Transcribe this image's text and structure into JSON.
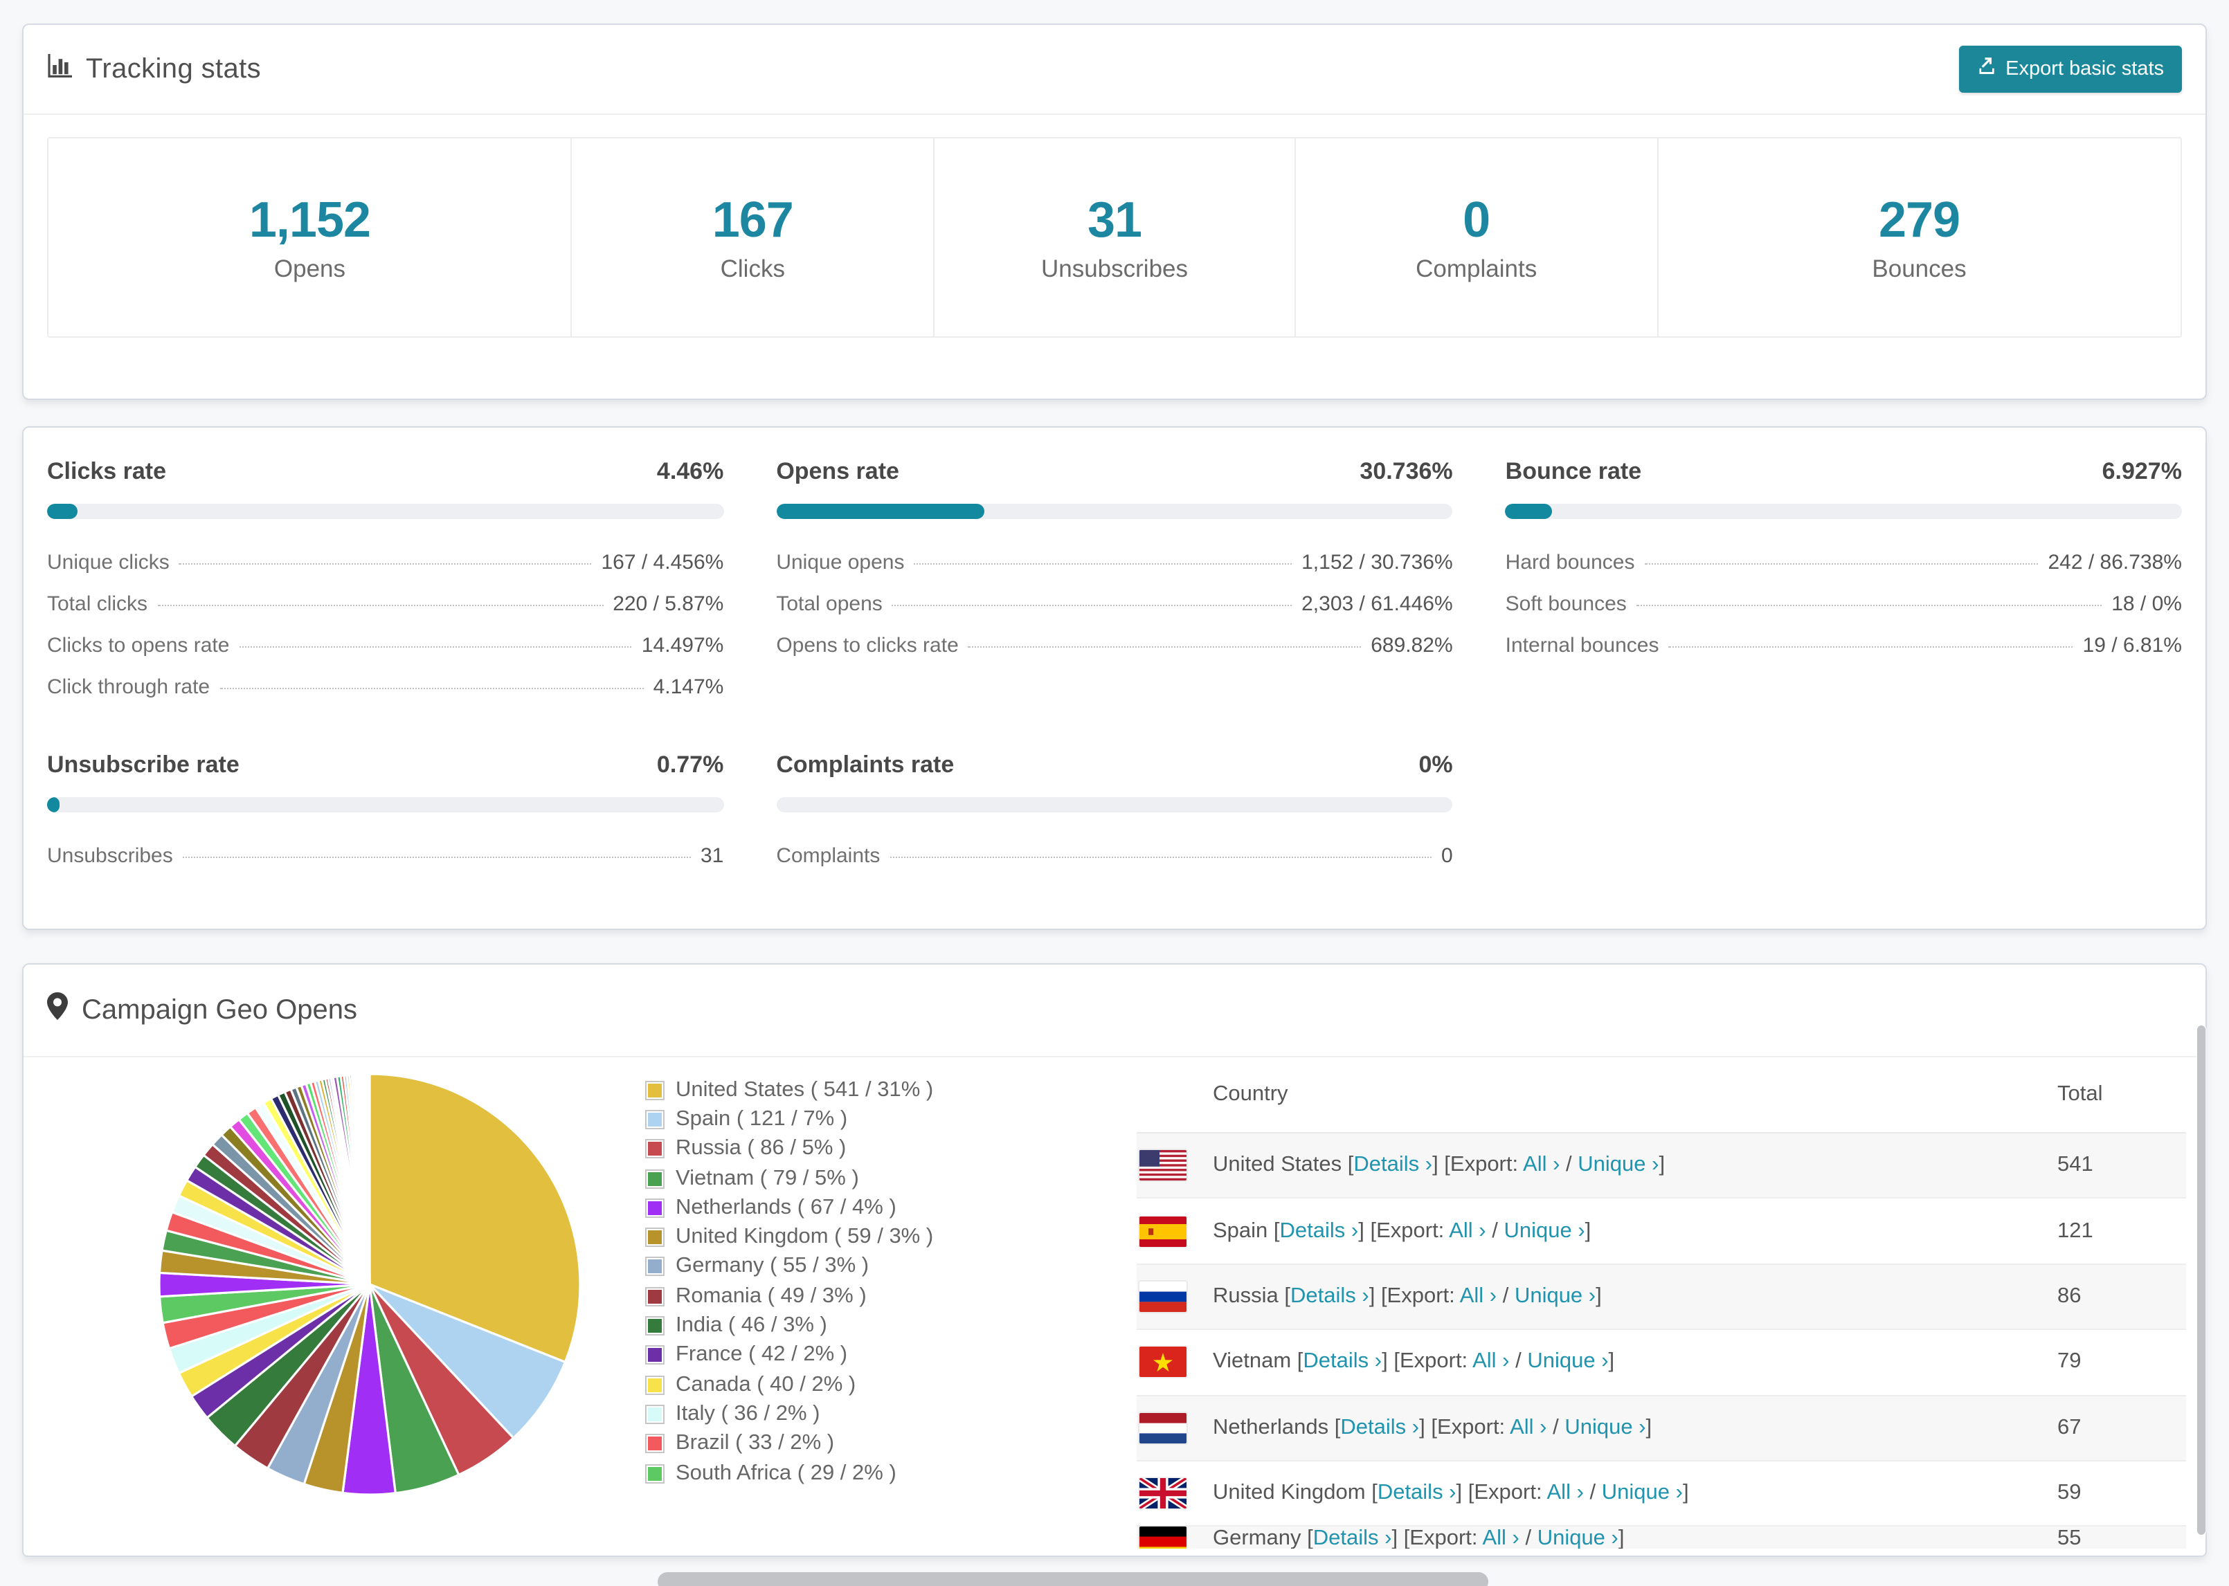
{
  "page": {
    "accent": "#1b8799",
    "accent_text": "#1d87a2",
    "link_color": "#2093ae",
    "background": "#f7f8f9"
  },
  "tracking": {
    "title": "Tracking stats",
    "export_button": "Export basic stats",
    "stats": [
      {
        "value": "1,152",
        "label": "Opens"
      },
      {
        "value": "167",
        "label": "Clicks"
      },
      {
        "value": "31",
        "label": "Unsubscribes"
      },
      {
        "value": "0",
        "label": "Complaints"
      },
      {
        "value": "279",
        "label": "Bounces"
      }
    ]
  },
  "rates": {
    "blocks": [
      {
        "title": "Clicks rate",
        "percent": "4.46%",
        "bar_pct": 4.46,
        "rows": [
          {
            "label": "Unique clicks",
            "value": "167 / 4.456%"
          },
          {
            "label": "Total clicks",
            "value": "220 / 5.87%"
          },
          {
            "label": "Clicks to opens rate",
            "value": "14.497%"
          },
          {
            "label": "Click through rate",
            "value": "4.147%"
          }
        ]
      },
      {
        "title": "Opens rate",
        "percent": "30.736%",
        "bar_pct": 30.736,
        "rows": [
          {
            "label": "Unique opens",
            "value": "1,152 / 30.736%"
          },
          {
            "label": "Total opens",
            "value": "2,303 / 61.446%"
          },
          {
            "label": "Opens to clicks rate",
            "value": "689.82%"
          }
        ]
      },
      {
        "title": "Bounce rate",
        "percent": "6.927%",
        "bar_pct": 6.927,
        "rows": [
          {
            "label": "Hard bounces",
            "value": "242 / 86.738%"
          },
          {
            "label": "Soft bounces",
            "value": "18 / 0%"
          },
          {
            "label": "Internal bounces",
            "value": "19 / 6.81%"
          }
        ]
      },
      {
        "title": "Unsubscribe rate",
        "percent": "0.77%",
        "bar_pct": 0.77,
        "rows": [
          {
            "label": "Unsubscribes",
            "value": "31"
          }
        ]
      },
      {
        "title": "Complaints rate",
        "percent": "0%",
        "bar_pct": 0,
        "rows": [
          {
            "label": "Complaints",
            "value": "0"
          }
        ]
      }
    ]
  },
  "geo": {
    "title": "Campaign Geo Opens",
    "table": {
      "headers": [
        "Country",
        "Total"
      ],
      "bracket_open": "[",
      "bracket_close": "]",
      "details_label": "Details ›",
      "export_prefix": "] [Export: ",
      "all_label": "All ›",
      "separator": " / ",
      "unique_label": "Unique ›",
      "rows": [
        {
          "country": "United States",
          "flag": "us",
          "total": "541",
          "partial": false
        },
        {
          "country": "Spain",
          "flag": "es",
          "total": "121",
          "partial": false
        },
        {
          "country": "Russia",
          "flag": "ru",
          "total": "86",
          "partial": false
        },
        {
          "country": "Vietnam",
          "flag": "vn",
          "total": "79",
          "partial": false
        },
        {
          "country": "Netherlands",
          "flag": "nl",
          "total": "67",
          "partial": false
        },
        {
          "country": "United Kingdom",
          "flag": "gb",
          "total": "59",
          "partial": false
        },
        {
          "country": "Germany",
          "flag": "de",
          "total": "55",
          "partial": true
        }
      ]
    }
  },
  "chart_data": {
    "type": "pie",
    "title": "Campaign Geo Opens",
    "unit": "opens",
    "legend_position": "right",
    "start_angle_deg": 0,
    "direction": "clockwise",
    "slices": [
      {
        "label": "United States",
        "value": 541,
        "pct": 31,
        "color": "#e3bf3f",
        "legend": "United States ( 541 / 31% )"
      },
      {
        "label": "Spain",
        "value": 121,
        "pct": 7,
        "color": "#aed3f0",
        "legend": "Spain ( 121 / 7% )"
      },
      {
        "label": "Russia",
        "value": 86,
        "pct": 5,
        "color": "#c74a50",
        "legend": "Russia ( 86 / 5% )"
      },
      {
        "label": "Vietnam",
        "value": 79,
        "pct": 5,
        "color": "#4ba152",
        "legend": "Vietnam ( 79 / 5% )"
      },
      {
        "label": "Netherlands",
        "value": 67,
        "pct": 4,
        "color": "#a02ef5",
        "legend": "Netherlands ( 67 / 4% )"
      },
      {
        "label": "United Kingdom",
        "value": 59,
        "pct": 3,
        "color": "#b8932b",
        "legend": "United Kingdom ( 59 / 3% )"
      },
      {
        "label": "Germany",
        "value": 55,
        "pct": 3,
        "color": "#92aecc",
        "legend": "Germany ( 55 / 3% )"
      },
      {
        "label": "Romania",
        "value": 49,
        "pct": 3,
        "color": "#a03a41",
        "legend": "Romania ( 49 / 3% )"
      },
      {
        "label": "India",
        "value": 46,
        "pct": 3,
        "color": "#357b3c",
        "legend": "India ( 46 / 3% )"
      },
      {
        "label": "France",
        "value": 42,
        "pct": 2,
        "color": "#6c2fa8",
        "legend": "France ( 42 / 2% )"
      },
      {
        "label": "Canada",
        "value": 40,
        "pct": 2,
        "color": "#f7e24a",
        "legend": "Canada ( 40 / 2% )"
      },
      {
        "label": "Italy",
        "value": 36,
        "pct": 2,
        "color": "#d6fbf9",
        "legend": "Italy ( 36 / 2% )"
      },
      {
        "label": "Brazil",
        "value": 33,
        "pct": 2,
        "color": "#f25a5e",
        "legend": "Brazil ( 33 / 2% )"
      },
      {
        "label": "South Africa",
        "value": 29,
        "pct": 2,
        "color": "#5dc963",
        "legend": "South Africa ( 29 / 2% )"
      }
    ],
    "other_slices": [
      [
        1.8,
        "#a02ef5"
      ],
      [
        1.7,
        "#b8932b"
      ],
      [
        1.55,
        "#4ba152"
      ],
      [
        1.45,
        "#f25a5e"
      ],
      [
        1.35,
        "#e4fbfb"
      ],
      [
        1.3,
        "#f7e24a"
      ],
      [
        1.2,
        "#6c2fa8"
      ],
      [
        1.1,
        "#357b3c"
      ],
      [
        1.05,
        "#a03a41"
      ],
      [
        1.0,
        "#7b95a8"
      ],
      [
        0.9,
        "#8a7d22"
      ],
      [
        0.85,
        "#e04de0"
      ],
      [
        0.8,
        "#64e578"
      ],
      [
        0.75,
        "#fa7070"
      ],
      [
        0.7,
        "#f2ffff"
      ],
      [
        0.65,
        "#ffff66"
      ],
      [
        0.6,
        "#2c2c6e"
      ],
      [
        0.55,
        "#1e5329"
      ],
      [
        0.5,
        "#7c3030"
      ],
      [
        0.45,
        "#5c7484"
      ],
      [
        0.4,
        "#8a7d22"
      ],
      [
        0.38,
        "#c45ef0"
      ],
      [
        0.35,
        "#53e06b"
      ],
      [
        0.32,
        "#ff6666"
      ],
      [
        0.3,
        "#a8d4f2"
      ],
      [
        0.28,
        "#d9a927"
      ],
      [
        0.25,
        "#2e8b43"
      ],
      [
        0.22,
        "#c03b3b"
      ],
      [
        0.2,
        "#6f86d6"
      ],
      [
        0.18,
        "#ff66ff"
      ],
      [
        0.3,
        "#9b59b6"
      ],
      [
        0.28,
        "#27ae60"
      ],
      [
        0.25,
        "#e74c3c"
      ],
      [
        0.22,
        "#85c1e9"
      ],
      [
        0.2,
        "#f1c40f"
      ],
      [
        0.18,
        "#1a5276"
      ],
      [
        0.1,
        "#784212"
      ],
      [
        0.1,
        "#ec7063"
      ],
      [
        0.09,
        "#58d68d"
      ],
      [
        0.09,
        "#af7ac5"
      ],
      [
        0.08,
        "#5dade2"
      ],
      [
        0.08,
        "#c0392b"
      ],
      [
        0.07,
        "#229954"
      ],
      [
        0.07,
        "#d35400"
      ],
      [
        0.06,
        "#7d3c98"
      ],
      [
        0.06,
        "#2e86c1"
      ],
      [
        0.05,
        "#cb4335"
      ],
      [
        0.05,
        "#17a589"
      ],
      [
        0.05,
        "#9a7d0a"
      ],
      [
        0.05,
        "#6c3483"
      ],
      [
        0.04,
        "#1f618d"
      ],
      [
        0.04,
        "#b03a2e"
      ],
      [
        0.04,
        "#148f77"
      ],
      [
        0.04,
        "#b7950b"
      ],
      [
        0.03,
        "#633974"
      ],
      [
        0.03,
        "#154360"
      ],
      [
        0.03,
        "#78281f"
      ],
      [
        0.03,
        "#0e6251"
      ],
      [
        0.03,
        "#7d6608"
      ],
      [
        0.02,
        "#4a235a"
      ],
      [
        0.02,
        "#0b5345"
      ]
    ]
  }
}
